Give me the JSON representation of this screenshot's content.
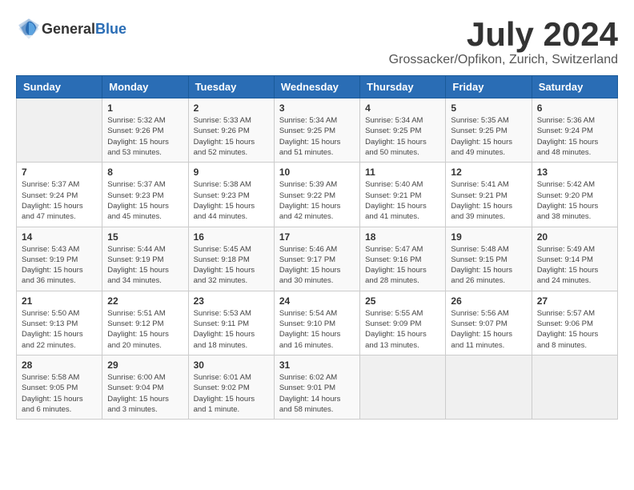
{
  "header": {
    "logo_general": "General",
    "logo_blue": "Blue",
    "month": "July 2024",
    "location": "Grossacker/Opfikon, Zurich, Switzerland"
  },
  "weekdays": [
    "Sunday",
    "Monday",
    "Tuesday",
    "Wednesday",
    "Thursday",
    "Friday",
    "Saturday"
  ],
  "weeks": [
    [
      {
        "day": "",
        "info": ""
      },
      {
        "day": "1",
        "info": "Sunrise: 5:32 AM\nSunset: 9:26 PM\nDaylight: 15 hours\nand 53 minutes."
      },
      {
        "day": "2",
        "info": "Sunrise: 5:33 AM\nSunset: 9:26 PM\nDaylight: 15 hours\nand 52 minutes."
      },
      {
        "day": "3",
        "info": "Sunrise: 5:34 AM\nSunset: 9:25 PM\nDaylight: 15 hours\nand 51 minutes."
      },
      {
        "day": "4",
        "info": "Sunrise: 5:34 AM\nSunset: 9:25 PM\nDaylight: 15 hours\nand 50 minutes."
      },
      {
        "day": "5",
        "info": "Sunrise: 5:35 AM\nSunset: 9:25 PM\nDaylight: 15 hours\nand 49 minutes."
      },
      {
        "day": "6",
        "info": "Sunrise: 5:36 AM\nSunset: 9:24 PM\nDaylight: 15 hours\nand 48 minutes."
      }
    ],
    [
      {
        "day": "7",
        "info": "Sunrise: 5:37 AM\nSunset: 9:24 PM\nDaylight: 15 hours\nand 47 minutes."
      },
      {
        "day": "8",
        "info": "Sunrise: 5:37 AM\nSunset: 9:23 PM\nDaylight: 15 hours\nand 45 minutes."
      },
      {
        "day": "9",
        "info": "Sunrise: 5:38 AM\nSunset: 9:23 PM\nDaylight: 15 hours\nand 44 minutes."
      },
      {
        "day": "10",
        "info": "Sunrise: 5:39 AM\nSunset: 9:22 PM\nDaylight: 15 hours\nand 42 minutes."
      },
      {
        "day": "11",
        "info": "Sunrise: 5:40 AM\nSunset: 9:21 PM\nDaylight: 15 hours\nand 41 minutes."
      },
      {
        "day": "12",
        "info": "Sunrise: 5:41 AM\nSunset: 9:21 PM\nDaylight: 15 hours\nand 39 minutes."
      },
      {
        "day": "13",
        "info": "Sunrise: 5:42 AM\nSunset: 9:20 PM\nDaylight: 15 hours\nand 38 minutes."
      }
    ],
    [
      {
        "day": "14",
        "info": "Sunrise: 5:43 AM\nSunset: 9:19 PM\nDaylight: 15 hours\nand 36 minutes."
      },
      {
        "day": "15",
        "info": "Sunrise: 5:44 AM\nSunset: 9:19 PM\nDaylight: 15 hours\nand 34 minutes."
      },
      {
        "day": "16",
        "info": "Sunrise: 5:45 AM\nSunset: 9:18 PM\nDaylight: 15 hours\nand 32 minutes."
      },
      {
        "day": "17",
        "info": "Sunrise: 5:46 AM\nSunset: 9:17 PM\nDaylight: 15 hours\nand 30 minutes."
      },
      {
        "day": "18",
        "info": "Sunrise: 5:47 AM\nSunset: 9:16 PM\nDaylight: 15 hours\nand 28 minutes."
      },
      {
        "day": "19",
        "info": "Sunrise: 5:48 AM\nSunset: 9:15 PM\nDaylight: 15 hours\nand 26 minutes."
      },
      {
        "day": "20",
        "info": "Sunrise: 5:49 AM\nSunset: 9:14 PM\nDaylight: 15 hours\nand 24 minutes."
      }
    ],
    [
      {
        "day": "21",
        "info": "Sunrise: 5:50 AM\nSunset: 9:13 PM\nDaylight: 15 hours\nand 22 minutes."
      },
      {
        "day": "22",
        "info": "Sunrise: 5:51 AM\nSunset: 9:12 PM\nDaylight: 15 hours\nand 20 minutes."
      },
      {
        "day": "23",
        "info": "Sunrise: 5:53 AM\nSunset: 9:11 PM\nDaylight: 15 hours\nand 18 minutes."
      },
      {
        "day": "24",
        "info": "Sunrise: 5:54 AM\nSunset: 9:10 PM\nDaylight: 15 hours\nand 16 minutes."
      },
      {
        "day": "25",
        "info": "Sunrise: 5:55 AM\nSunset: 9:09 PM\nDaylight: 15 hours\nand 13 minutes."
      },
      {
        "day": "26",
        "info": "Sunrise: 5:56 AM\nSunset: 9:07 PM\nDaylight: 15 hours\nand 11 minutes."
      },
      {
        "day": "27",
        "info": "Sunrise: 5:57 AM\nSunset: 9:06 PM\nDaylight: 15 hours\nand 8 minutes."
      }
    ],
    [
      {
        "day": "28",
        "info": "Sunrise: 5:58 AM\nSunset: 9:05 PM\nDaylight: 15 hours\nand 6 minutes."
      },
      {
        "day": "29",
        "info": "Sunrise: 6:00 AM\nSunset: 9:04 PM\nDaylight: 15 hours\nand 3 minutes."
      },
      {
        "day": "30",
        "info": "Sunrise: 6:01 AM\nSunset: 9:02 PM\nDaylight: 15 hours\nand 1 minute."
      },
      {
        "day": "31",
        "info": "Sunrise: 6:02 AM\nSunset: 9:01 PM\nDaylight: 14 hours\nand 58 minutes."
      },
      {
        "day": "",
        "info": ""
      },
      {
        "day": "",
        "info": ""
      },
      {
        "day": "",
        "info": ""
      }
    ]
  ]
}
